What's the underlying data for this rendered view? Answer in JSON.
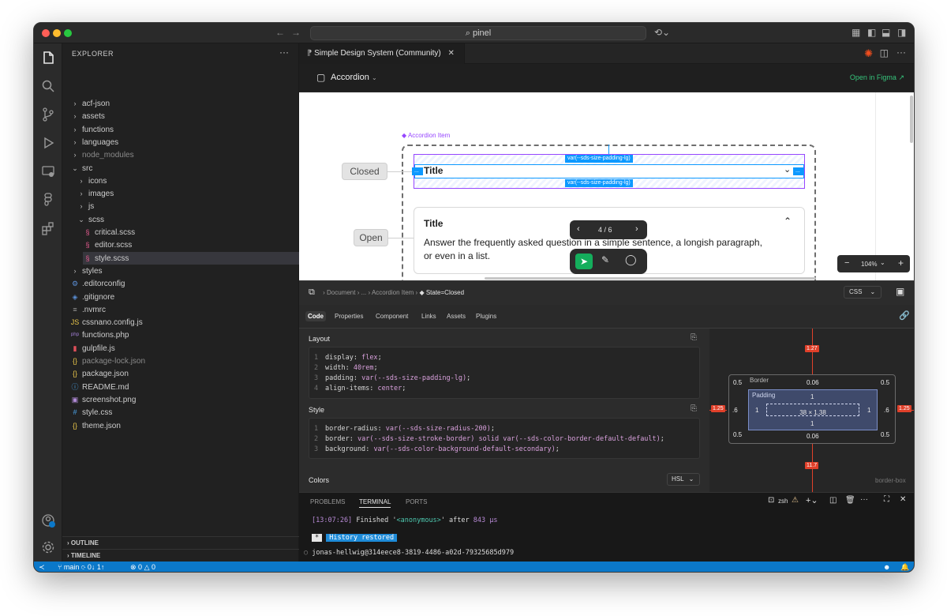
{
  "window": {
    "search_text": "pinel"
  },
  "sidebar": {
    "title": "EXPLORER",
    "items": [
      {
        "label": "acf-json",
        "icon": ">",
        "dim": false
      },
      {
        "label": "assets",
        "icon": ">",
        "dim": false
      },
      {
        "label": "functions",
        "icon": ">",
        "dim": false
      },
      {
        "label": "languages",
        "icon": ">",
        "dim": false
      },
      {
        "label": "node_modules",
        "icon": ">",
        "dim": true
      },
      {
        "label": "src",
        "icon": "v",
        "dim": false
      },
      {
        "label": "icons",
        "icon": ">",
        "dim": false
      },
      {
        "label": "images",
        "icon": ">",
        "dim": false
      },
      {
        "label": "js",
        "icon": ">",
        "dim": false
      },
      {
        "label": "scss",
        "icon": "v",
        "dim": false
      },
      {
        "label": "critical.scss",
        "icon": "scss",
        "dim": false
      },
      {
        "label": "editor.scss",
        "icon": "scss",
        "dim": false
      },
      {
        "label": "style.scss",
        "icon": "scss",
        "dim": false
      },
      {
        "label": "styles",
        "icon": ">",
        "dim": false
      },
      {
        "label": ".editorconfig",
        "icon": "gear",
        "dim": false
      },
      {
        "label": ".gitignore",
        "icon": "git",
        "dim": false
      },
      {
        "label": ".nvmrc",
        "icon": "list",
        "dim": false
      },
      {
        "label": "cssnano.config.js",
        "icon": "js",
        "dim": false
      },
      {
        "label": "functions.php",
        "icon": "php",
        "dim": false
      },
      {
        "label": "gulpfile.js",
        "icon": "gulp",
        "dim": false
      },
      {
        "label": "package-lock.json",
        "icon": "json",
        "dim": true
      },
      {
        "label": "package.json",
        "icon": "json",
        "dim": false
      },
      {
        "label": "README.md",
        "icon": "info",
        "dim": false
      },
      {
        "label": "screenshot.png",
        "icon": "img",
        "dim": false
      },
      {
        "label": "style.css",
        "icon": "hash",
        "dim": false
      },
      {
        "label": "theme.json",
        "icon": "json",
        "dim": false
      }
    ],
    "outline_label": "OUTLINE",
    "timeline_label": "TIMELINE"
  },
  "tab": {
    "title": "Simple Design System (Community)"
  },
  "figma_header": {
    "component": "Accordion",
    "open_link": "Open in Figma"
  },
  "canvas": {
    "frame_label": "Accordion Item",
    "closed_pill": "Closed",
    "open_pill": "Open",
    "padding_tag": "var(--sds-size-padding-lg)",
    "title_closed": "Title",
    "title_open": "Title",
    "body_open": "Answer the frequently asked question in a simple sentence, a longish paragraph, or even in a list.",
    "pager": "4 / 6",
    "zoom": "104%"
  },
  "inspect": {
    "breadcrumb": [
      "Document",
      "...",
      "Accordion Item",
      "State=Closed"
    ],
    "lang": "CSS",
    "tabs": [
      "Code",
      "Properties",
      "Component",
      "Links",
      "Assets",
      "Plugins"
    ],
    "layout_label": "Layout",
    "style_label": "Style",
    "colors_label": "Colors",
    "colors_format": "HSL",
    "layout_code": [
      {
        "prop": "display",
        "val": "flex"
      },
      {
        "prop": "width",
        "val": "40rem"
      },
      {
        "prop": "padding",
        "val": "var(--sds-size-padding-lg)"
      },
      {
        "prop": "align-items",
        "val": "center"
      }
    ],
    "style_code": [
      {
        "prop": "border-radius",
        "val": "var(--sds-size-radius-200)"
      },
      {
        "prop": "border",
        "val": "var(--sds-size-stroke-border) solid var(--sds-color-border-default-default)"
      },
      {
        "prop": "background",
        "val": "var(--sds-color-background-default-secondary)"
      }
    ],
    "boxmodel": {
      "margin_top": "1.27",
      "margin_bottom": "11.7",
      "margin_left": "1.25",
      "margin_right": "1.25",
      "border_label": "Border",
      "border_top": "0.06",
      "border_bottom": "0.06",
      "border_left": ".6",
      "border_right": ".6",
      "radius_tl": "0.5",
      "radius_tr": "0.5",
      "radius_bl": "0.5",
      "radius_br": "0.5",
      "padding_label": "Padding",
      "padding_top": "1",
      "padding_bottom": "1",
      "padding_left": "1",
      "padding_right": "1",
      "content_size": "38 × 1.38",
      "box_type": "border-box"
    }
  },
  "terminal": {
    "tabs": [
      "PROBLEMS",
      "TERMINAL",
      "PORTS"
    ],
    "shell": "zsh",
    "line1_time": "[13:07:26]",
    "line1_text": "Finished '",
    "line1_anon": "<anonymous>",
    "line1_after": "' after ",
    "line1_dur": "843 μs",
    "history": "History restored",
    "prompt": "jonas-hellwig@314eece8-3819-4486-a02d-79325685d979"
  },
  "statusbar": {
    "branch": "main",
    "sync": "0↓ 1↑",
    "errors": "0",
    "warnings": "0"
  }
}
